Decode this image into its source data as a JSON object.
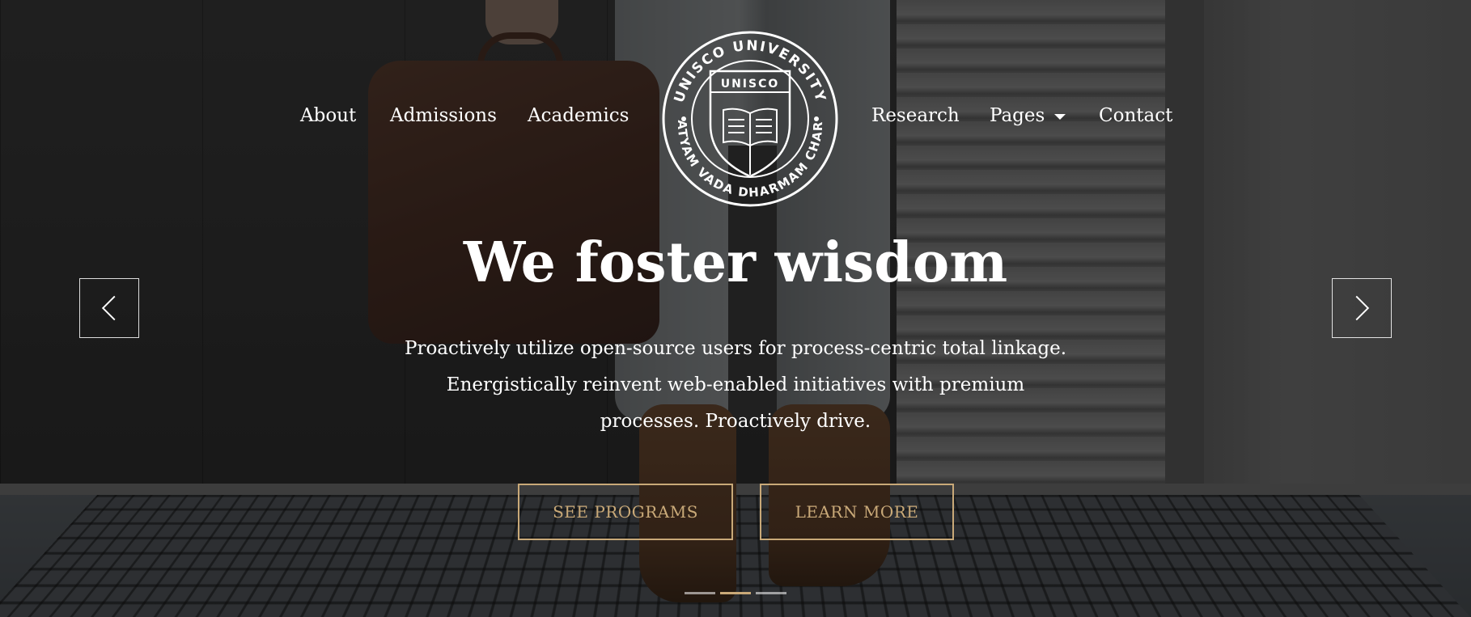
{
  "colors": {
    "accent": "#c9a978",
    "text": "#ffffff",
    "overlay": "rgba(0,0,0,0.45)"
  },
  "nav": {
    "left_items": [
      {
        "label": "About"
      },
      {
        "label": "Admissions"
      },
      {
        "label": "Academics"
      }
    ],
    "right_items": [
      {
        "label": "Research"
      },
      {
        "label": "Pages",
        "has_dropdown": true,
        "icon": "caret-down-icon"
      },
      {
        "label": "Contact"
      }
    ]
  },
  "logo": {
    "top_ring_text": "UNISCO UNIVERSITY",
    "bottom_ring_text": "SATYAM VADA DHARMAM CHARA",
    "shield_text": "UNISCO",
    "icon": "open-book-icon"
  },
  "hero": {
    "title": "We foster wisdom",
    "description": "Proactively utilize open-source users for process-centric total linkage. Energistically reinvent web-enabled initiatives with premium processes. Proactively drive.",
    "buttons": {
      "primary_label": "SEE PROGRAMS",
      "secondary_label": "LEARN MORE"
    }
  },
  "carousel": {
    "prev_icon": "chevron-left-icon",
    "next_icon": "chevron-right-icon",
    "slide_count": 3,
    "active_index": 1
  }
}
